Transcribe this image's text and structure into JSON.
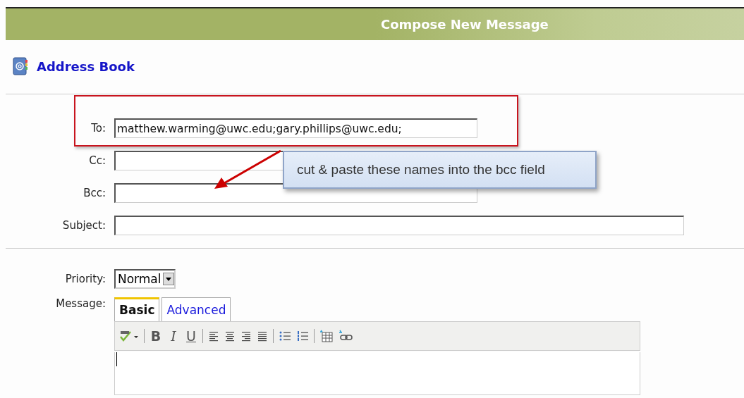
{
  "header": {
    "title": "Compose New Message"
  },
  "address_book": {
    "label": "Address Book"
  },
  "recipients": [
    {
      "label": "To:",
      "value": "matthew.warming@uwc.edu;gary.phillips@uwc.edu;"
    },
    {
      "label": "Cc:"
    },
    {
      "label": "Bcc:"
    },
    {
      "label": "Subject:"
    }
  ],
  "priority": {
    "label": "Priority:",
    "value": "Normal"
  },
  "message": {
    "label": "Message:"
  },
  "tabs": [
    {
      "label": "Basic",
      "selected": true
    },
    {
      "label": "Advanced",
      "selected": false
    }
  ],
  "toolbar": [
    {
      "kind": "spell"
    },
    {
      "kind": "sep"
    },
    {
      "kind": "bold",
      "text": "B"
    },
    {
      "kind": "italic",
      "text": "I"
    },
    {
      "kind": "underline",
      "text": "U"
    },
    {
      "kind": "sep"
    },
    {
      "kind": "left"
    },
    {
      "kind": "center"
    },
    {
      "kind": "right"
    },
    {
      "kind": "justify"
    },
    {
      "kind": "sep"
    },
    {
      "kind": "bullets"
    },
    {
      "kind": "numbers"
    },
    {
      "kind": "sep"
    },
    {
      "kind": "table"
    },
    {
      "kind": "link"
    }
  ],
  "annotation": {
    "callout": "cut & paste these names into the bcc field"
  }
}
